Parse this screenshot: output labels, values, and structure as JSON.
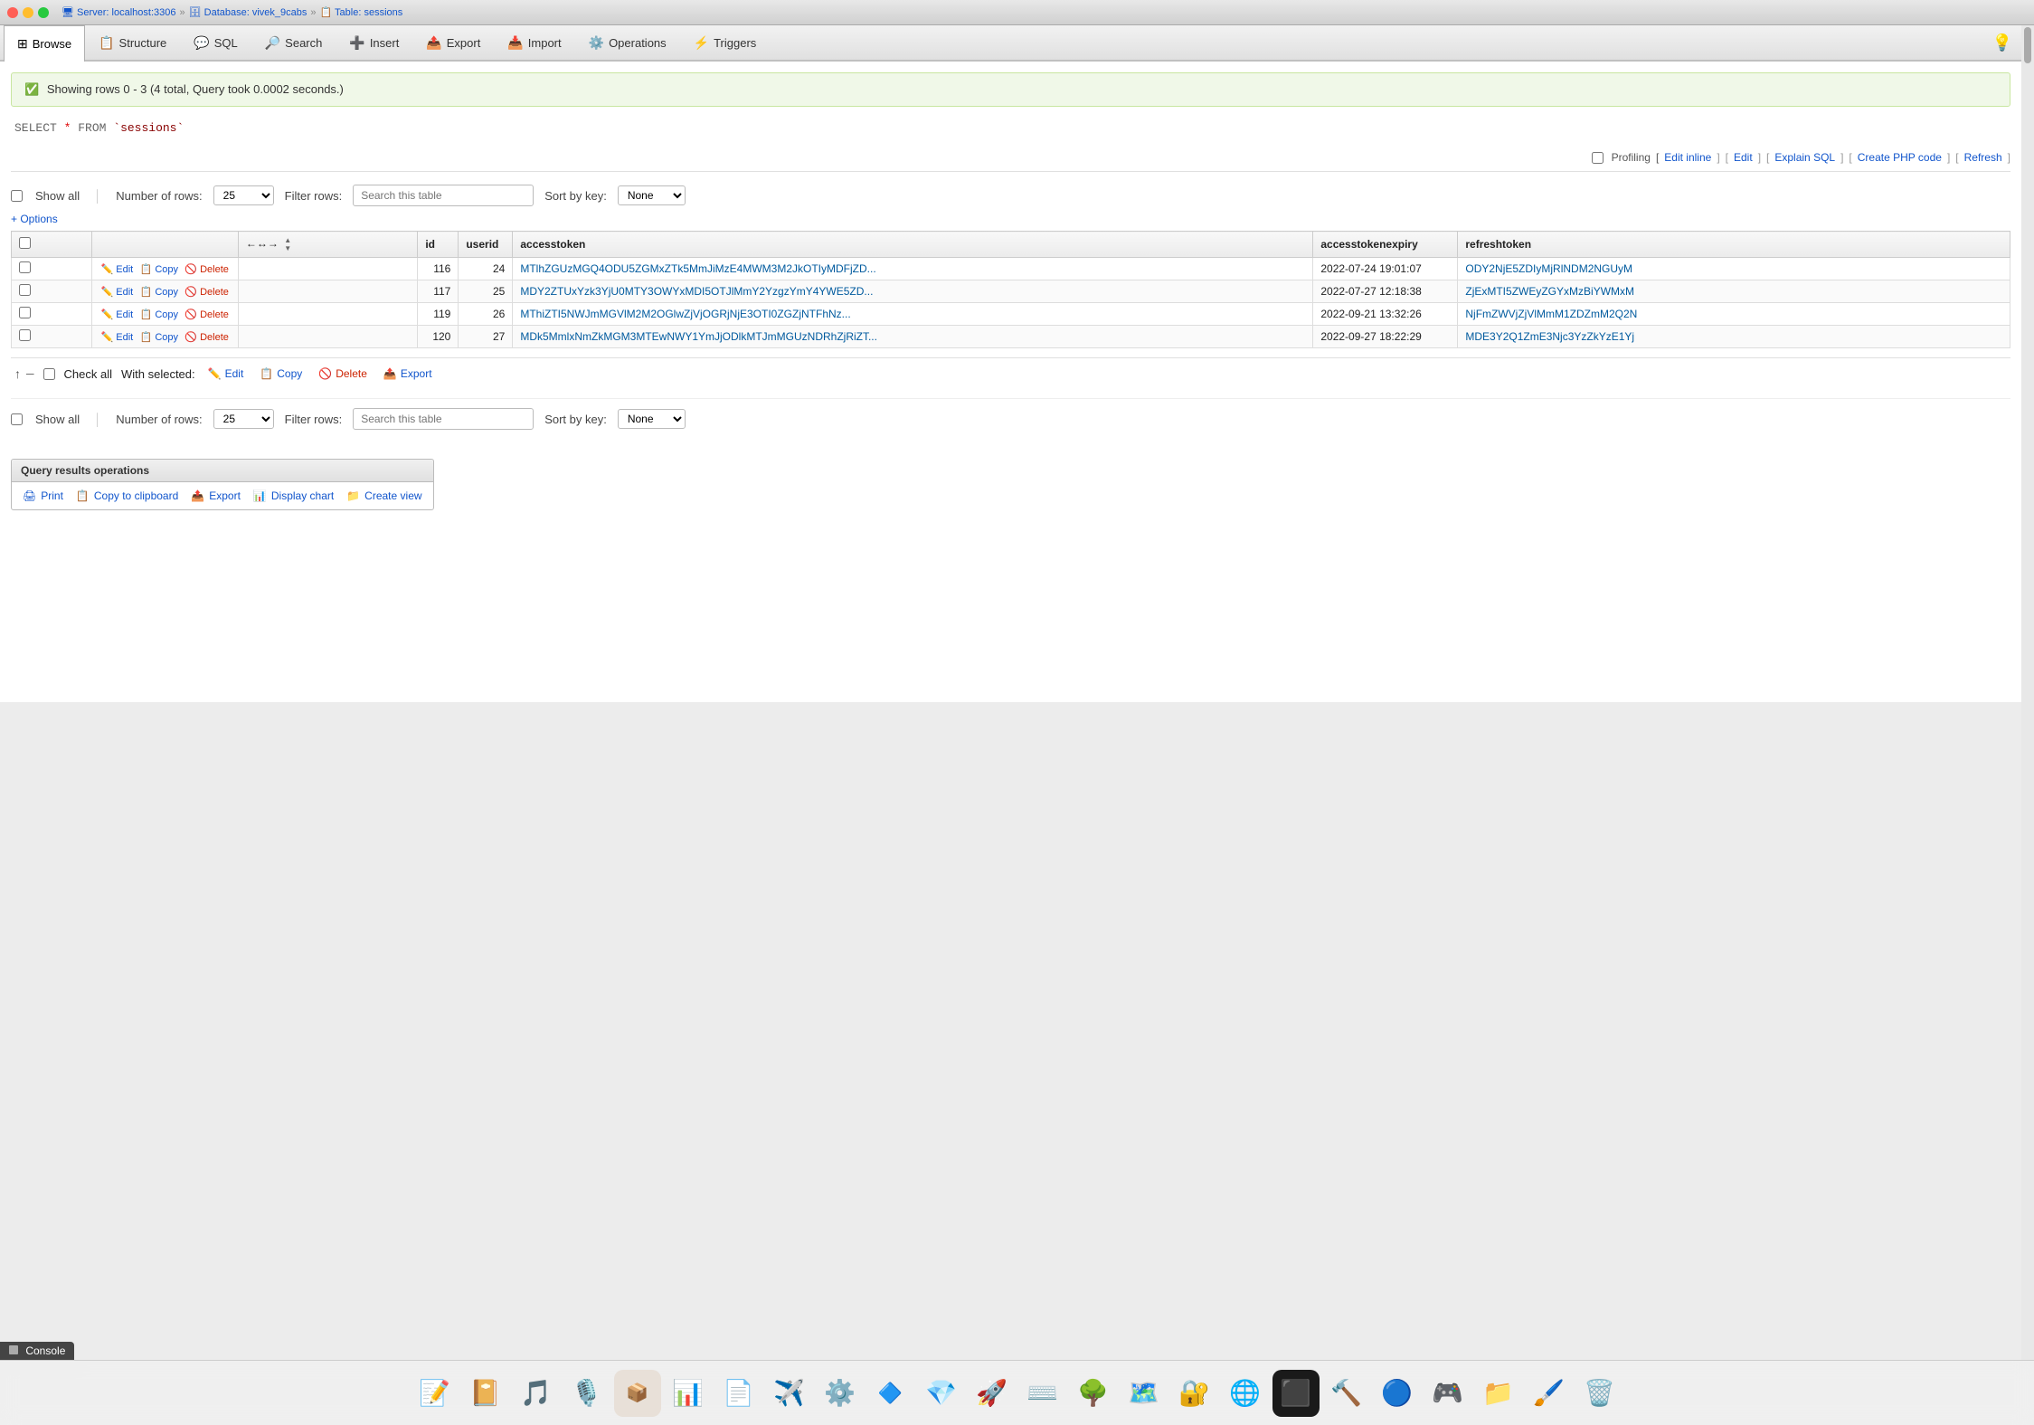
{
  "titlebar": {
    "breadcrumb": [
      {
        "label": "Server: localhost:3306",
        "type": "server"
      },
      {
        "label": "Database: vivek_9cabs",
        "type": "database"
      },
      {
        "label": "Table: sessions",
        "type": "table"
      }
    ]
  },
  "tabs": [
    {
      "id": "browse",
      "label": "Browse",
      "icon": "🔍",
      "active": true
    },
    {
      "id": "structure",
      "label": "Structure",
      "icon": "📋",
      "active": false
    },
    {
      "id": "sql",
      "label": "SQL",
      "icon": "💬",
      "active": false
    },
    {
      "id": "search",
      "label": "Search",
      "icon": "🔎",
      "active": false
    },
    {
      "id": "insert",
      "label": "Insert",
      "icon": "➕",
      "active": false
    },
    {
      "id": "export",
      "label": "Export",
      "icon": "📤",
      "active": false
    },
    {
      "id": "import",
      "label": "Import",
      "icon": "📥",
      "active": false
    },
    {
      "id": "operations",
      "label": "Operations",
      "icon": "⚙️",
      "active": false
    },
    {
      "id": "triggers",
      "label": "Triggers",
      "icon": "⚡",
      "active": false
    }
  ],
  "success_message": "Showing rows 0 - 3 (4 total, Query took 0.0002 seconds.)",
  "sql_query": "SELECT * FROM `sessions`",
  "profiling": {
    "label": "Profiling",
    "edit_inline": "Edit inline",
    "edit": "Edit",
    "explain_sql": "Explain SQL",
    "create_php": "Create PHP code",
    "refresh": "Refresh"
  },
  "table_controls_top": {
    "show_all_label": "Show all",
    "num_rows_label": "Number of rows:",
    "num_rows_value": "25",
    "filter_rows_label": "Filter rows:",
    "filter_placeholder": "Search this table",
    "sort_by_key_label": "Sort by key:",
    "sort_none": "None"
  },
  "options_label": "+ Options",
  "table_headers": [
    {
      "id": "checkbox_col",
      "label": ""
    },
    {
      "id": "actions_col",
      "label": ""
    },
    {
      "id": "sort_col",
      "label": "↔",
      "sortable": true
    },
    {
      "id": "id",
      "label": "id",
      "sortable": true
    },
    {
      "id": "userid",
      "label": "userid",
      "sortable": true
    },
    {
      "id": "accesstoken",
      "label": "accesstoken",
      "sortable": true
    },
    {
      "id": "accesstokenexpiry",
      "label": "accesstokenexpiry",
      "sortable": true
    },
    {
      "id": "refreshtoken",
      "label": "refreshtoken",
      "sortable": true
    }
  ],
  "rows": [
    {
      "id": "116",
      "userid": "24",
      "accesstoken": "MTlhZGUzMGQ4ODU5ZGMxZTk5MmJiMzE4MWM3M2JkOTIyMDFjZD...",
      "accesstokenexpiry": "2022-07-24 19:01:07",
      "refreshtoken": "ODY2NjE5ZDIyMjRlNDM2NGUyM"
    },
    {
      "id": "117",
      "userid": "25",
      "accesstoken": "MDY2ZTUxYzk3YjU0MTY3OWYxMDI5OTJlMmY2YzgzYmY4YWE5ZD...",
      "accesstokenexpiry": "2022-07-27 12:18:38",
      "refreshtoken": "ZjExMTI5ZWEyZGYxMzBiYWMxM"
    },
    {
      "id": "119",
      "userid": "26",
      "accesstoken": "MThiZTI5NWJmMGVlM2M2OGlwZjVjOGRjNjE3OTI0ZGZjNTFhNz...",
      "accesstokenexpiry": "2022-09-21 13:32:26",
      "refreshtoken": "NjFmZWVjZjVlMmM1ZDZmM2Q2N"
    },
    {
      "id": "120",
      "userid": "27",
      "accesstoken": "MDk5MmlxNmZkMGM3MTEwNWY1YmJjODlkMTJmMGUzNDRhZjRiZT...",
      "accesstokenexpiry": "2022-09-27 18:22:29",
      "refreshtoken": "MDE3Y2Q1ZmE3Njc3YzZkYzE1Yj"
    }
  ],
  "with_selected": {
    "check_all": "Check all",
    "label": "With selected:",
    "edit": "Edit",
    "copy": "Copy",
    "delete": "Delete",
    "export": "Export"
  },
  "table_controls_bottom": {
    "show_all_label": "Show all",
    "num_rows_label": "Number of rows:",
    "num_rows_value": "25",
    "filter_rows_label": "Filter rows:",
    "filter_placeholder": "Search this table",
    "sort_by_key_label": "Sort by key:",
    "sort_none": "None"
  },
  "query_results_operations": {
    "title": "Query results operations",
    "print": "Print",
    "copy_to_clipboard": "Copy to clipboard",
    "export": "Export",
    "display_chart": "Display chart",
    "create_view": "Create view"
  },
  "console": {
    "label": "Console"
  },
  "dock_apps": [
    {
      "id": "reminders",
      "icon": "📝",
      "label": "Reminders"
    },
    {
      "id": "notes",
      "icon": "📔",
      "label": "Notes"
    },
    {
      "id": "music",
      "icon": "🎵",
      "label": "Music"
    },
    {
      "id": "podcasts",
      "icon": "🎙️",
      "label": "Podcasts"
    },
    {
      "id": "canister",
      "icon": "🗂️",
      "label": "Canister"
    },
    {
      "id": "numbers",
      "icon": "📊",
      "label": "Numbers"
    },
    {
      "id": "testflight",
      "icon": "✈️",
      "label": "TestFlight"
    },
    {
      "id": "settings",
      "icon": "⚙️",
      "label": "System Settings"
    },
    {
      "id": "blender",
      "icon": "🔷",
      "label": "Blender"
    },
    {
      "id": "rubymine",
      "icon": "💎",
      "label": "RubyMine"
    },
    {
      "id": "transmit",
      "icon": "🚀",
      "label": "Transmit"
    },
    {
      "id": "shortcuts",
      "icon": "⌨️",
      "label": "Shortcuts"
    },
    {
      "id": "source-tree",
      "icon": "🌳",
      "label": "Sourcetree"
    },
    {
      "id": "maps",
      "icon": "🗺️",
      "label": "Maps"
    },
    {
      "id": "openvpn",
      "icon": "🔐",
      "label": "OpenVPN"
    },
    {
      "id": "chrome",
      "icon": "🌐",
      "label": "Google Chrome"
    },
    {
      "id": "terminal",
      "icon": "⬛",
      "label": "Terminal"
    },
    {
      "id": "xcode-tools",
      "icon": "🔨",
      "label": "Instruments"
    },
    {
      "id": "vscode",
      "icon": "🔵",
      "label": "VS Code"
    },
    {
      "id": "steam",
      "icon": "🎮",
      "label": "Steam"
    },
    {
      "id": "finder-ext",
      "icon": "📁",
      "label": "Finder"
    },
    {
      "id": "pixelmator",
      "icon": "🖌️",
      "label": "Pixelmator"
    },
    {
      "id": "trash",
      "icon": "🗑️",
      "label": "Trash"
    }
  ]
}
